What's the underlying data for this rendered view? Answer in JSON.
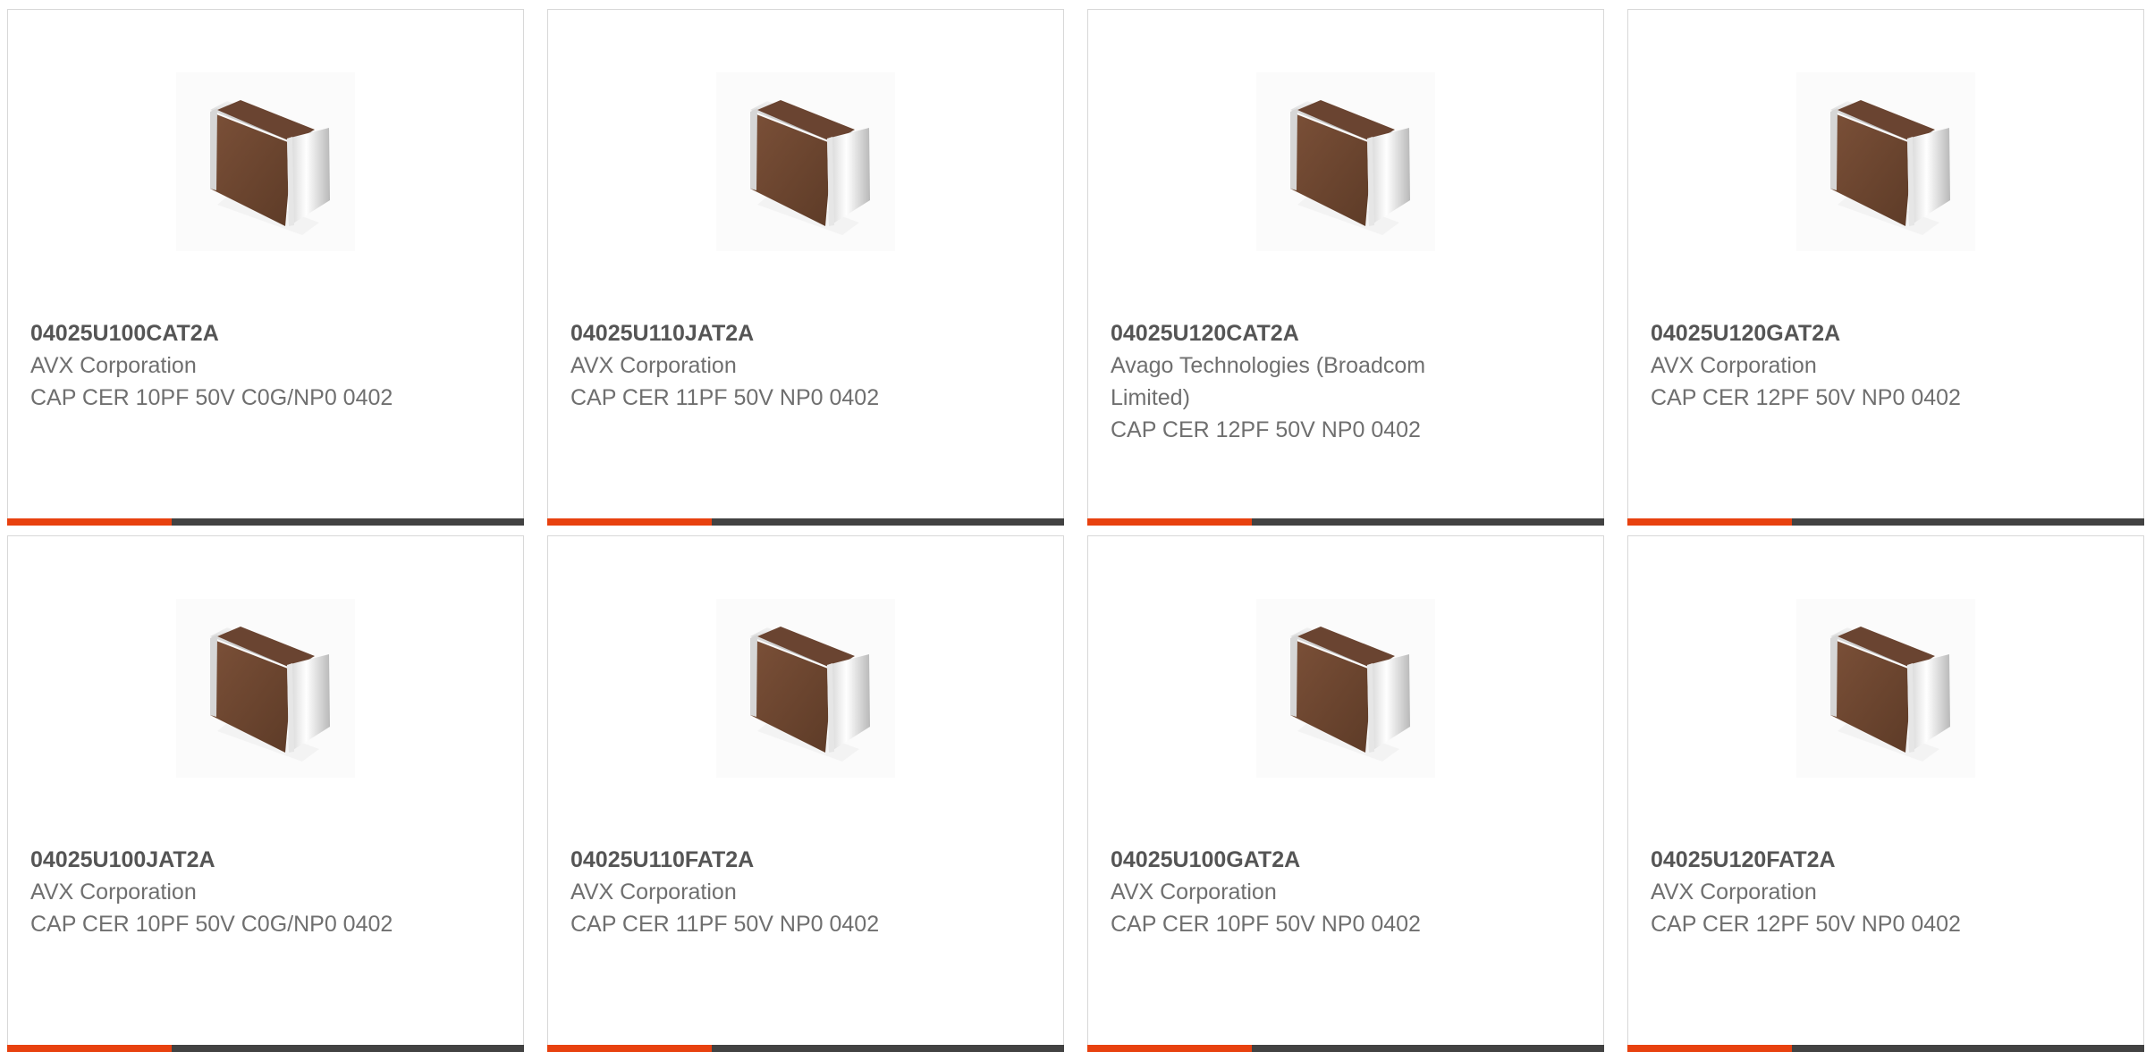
{
  "colors": {
    "accent": "#e8410f",
    "bar_dark": "#424242"
  },
  "products": [
    {
      "part_number": "04025U100CAT2A",
      "manufacturer": "AVX Corporation",
      "description": "CAP CER 10PF 50V C0G/NP0 0402",
      "image_icon": "capacitor-chip-icon"
    },
    {
      "part_number": "04025U110JAT2A",
      "manufacturer": "AVX Corporation",
      "description": "CAP CER 11PF 50V NP0 0402",
      "image_icon": "capacitor-chip-icon"
    },
    {
      "part_number": "04025U120CAT2A",
      "manufacturer": "Avago Technologies (Broadcom Limited)",
      "description": "CAP CER 12PF 50V NP0 0402",
      "image_icon": "capacitor-chip-icon"
    },
    {
      "part_number": "04025U120GAT2A",
      "manufacturer": "AVX Corporation",
      "description": "CAP CER 12PF 50V NP0 0402",
      "image_icon": "capacitor-chip-icon"
    },
    {
      "part_number": "04025U100JAT2A",
      "manufacturer": "AVX Corporation",
      "description": "CAP CER 10PF 50V C0G/NP0 0402",
      "image_icon": "capacitor-chip-icon"
    },
    {
      "part_number": "04025U110FAT2A",
      "manufacturer": "AVX Corporation",
      "description": "CAP CER 11PF 50V NP0 0402",
      "image_icon": "capacitor-chip-icon"
    },
    {
      "part_number": "04025U100GAT2A",
      "manufacturer": "AVX Corporation",
      "description": "CAP CER 10PF 50V NP0 0402",
      "image_icon": "capacitor-chip-icon"
    },
    {
      "part_number": "04025U120FAT2A",
      "manufacturer": "AVX Corporation",
      "description": "CAP CER 12PF 50V NP0 0402",
      "image_icon": "capacitor-chip-icon"
    }
  ]
}
